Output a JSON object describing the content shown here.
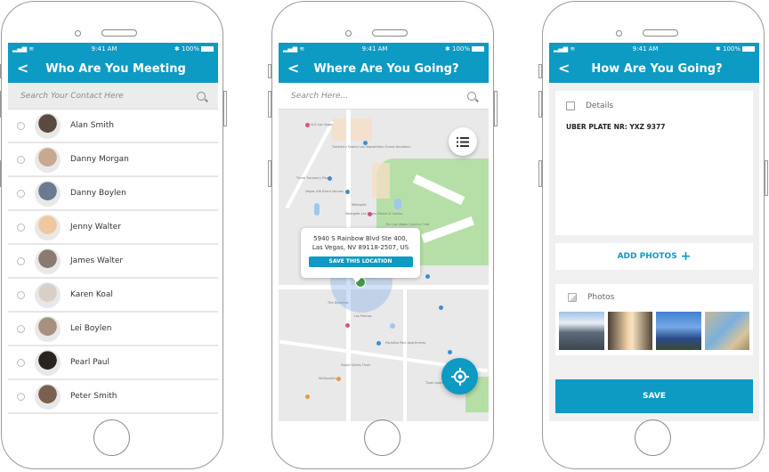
{
  "status_bar": {
    "time": "9:41 AM",
    "battery": "100%"
  },
  "colors": {
    "accent": "#0d9ac3",
    "marker": "#3e9a4a",
    "park": "#b6dfa7"
  },
  "screen1": {
    "title": "Who Are You Meeting",
    "back_icon": "chevron-left-icon",
    "search": {
      "placeholder": "Search Your Contact Here",
      "value": ""
    },
    "contacts": [
      {
        "name": "Alan Smith",
        "selected": false
      },
      {
        "name": "Danny Morgan",
        "selected": false
      },
      {
        "name": "Danny Boylen",
        "selected": false
      },
      {
        "name": "Jenny Walter",
        "selected": false
      },
      {
        "name": "James Walter",
        "selected": false
      },
      {
        "name": "Karen Koal",
        "selected": false
      },
      {
        "name": "Lei Boylen",
        "selected": false
      },
      {
        "name": "Pearl Paul",
        "selected": false
      },
      {
        "name": "Peter Smith",
        "selected": false
      }
    ]
  },
  "screen2": {
    "title": "Where Are You Going?",
    "search": {
      "placeholder": "Search Here...",
      "value": ""
    },
    "popup": {
      "address_line1": "5940 S Rainbow Blvd Ste 400,",
      "address_line2": "Las Vegas, NV 89118-2507, US",
      "button": "SAVE THIS LOCATION"
    },
    "map_labels": [
      "SLS Las Vegas",
      "Turnberry Towers Las Vegas",
      "Three Turnberry Place",
      "Vegas Life Event Venues",
      "Westgate",
      "Westgate Las Vegas Resort & Casino",
      "Hilton Grand Vacations",
      "The Las Vegas Country Club",
      "Paradise Park Apartments",
      "Tivoli Apartments",
      "McDonald's",
      "Las Palmas",
      "Siegel Suites Tivoli",
      "The Diplomat"
    ]
  },
  "screen3": {
    "title": "How Are You Going?",
    "details_label": "Details",
    "plate": "UBER PLATE NR: YXZ 9377",
    "add_photos": "ADD PHOTOS",
    "photos_label": "Photos",
    "photos": [
      "city-skyline-mountains",
      "street-sunset",
      "skyline-blue-sky",
      "mall-interior"
    ],
    "save": "SAVE"
  }
}
